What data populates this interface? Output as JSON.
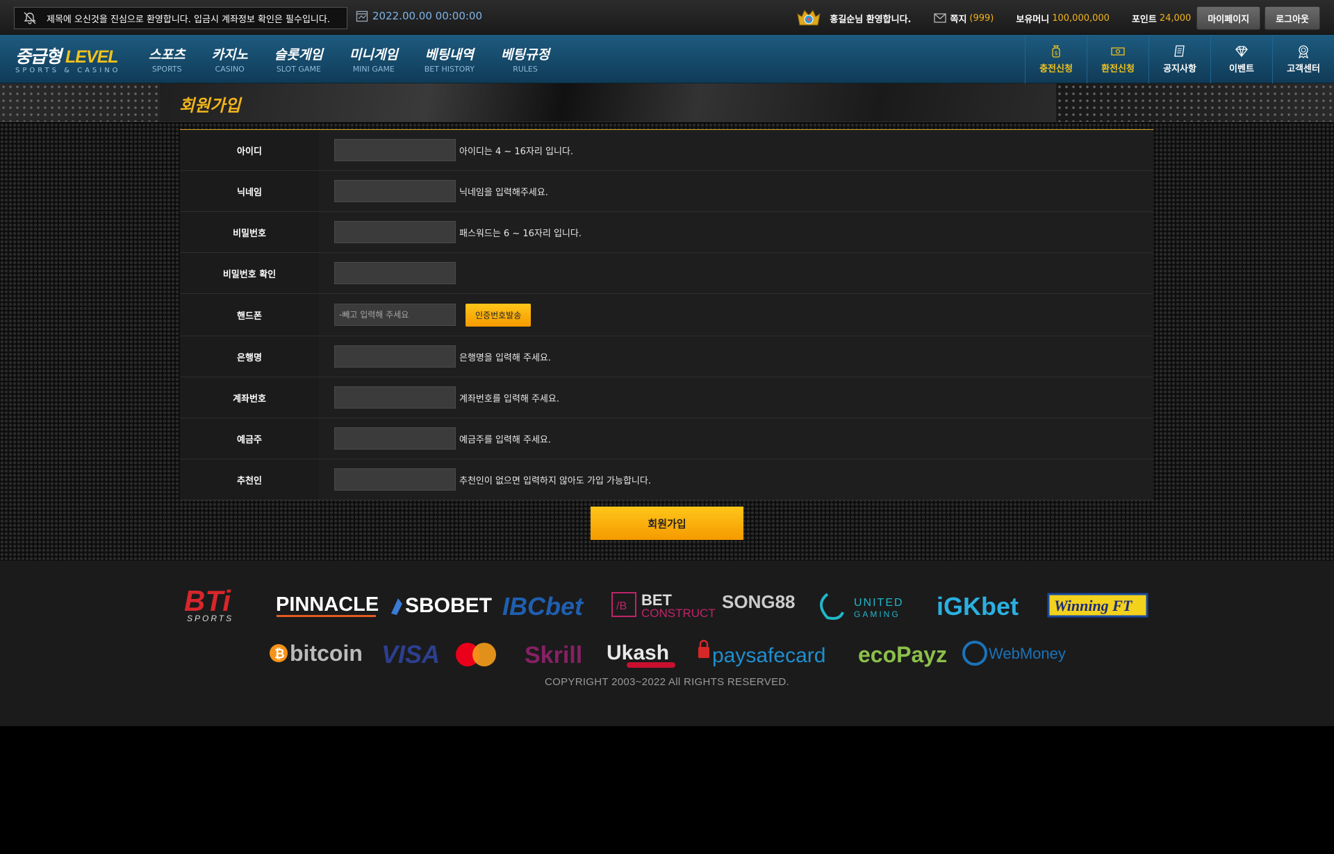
{
  "topbar": {
    "notice": "제목에 오신것을 진심으로 환영합니다. 입금시 계좌정보 확인은 필수입니다.",
    "datetime": "2022.00.00  00:00:00",
    "welcome": "홍길순님 환영합니다.",
    "message_label": "쪽지",
    "message_count": "(999)",
    "money_label": "보유머니",
    "money_value": "100,000,000",
    "point_label": "포인트",
    "point_value": "24,000",
    "mypage_button": "마이페이지",
    "logout_button": "로그아웃"
  },
  "logo": {
    "main_a": "중급형",
    "main_b": "LEVEL",
    "sub": "SPORTS & CASINO"
  },
  "nav": [
    {
      "kr": "스포츠",
      "en": "SPORTS"
    },
    {
      "kr": "카지노",
      "en": "CASINO"
    },
    {
      "kr": "슬롯게임",
      "en": "SLOT GAME"
    },
    {
      "kr": "미니게임",
      "en": "MINI GAME"
    },
    {
      "kr": "베팅내역",
      "en": "BET HISTORY"
    },
    {
      "kr": "베팅규정",
      "en": "RULES"
    }
  ],
  "quicknav": [
    {
      "label": "충전신청",
      "icon": "money-bag-icon"
    },
    {
      "label": "환전신청",
      "icon": "cash-icon"
    },
    {
      "label": "공지사항",
      "icon": "notice-icon"
    },
    {
      "label": "이벤트",
      "icon": "diamond-icon"
    },
    {
      "label": "고객센터",
      "icon": "medal-icon"
    }
  ],
  "page_title": "회원가입",
  "form": {
    "rows": [
      {
        "label": "아이디",
        "placeholder": "",
        "hint": "아이디는 4 ~ 16자리 입니다."
      },
      {
        "label": "닉네임",
        "placeholder": "",
        "hint": "닉네임을 입력해주세요."
      },
      {
        "label": "비밀번호",
        "placeholder": "",
        "hint": "패스워드는 6 ~ 16자리 입니다."
      },
      {
        "label": "비밀번호 확인",
        "placeholder": "",
        "hint": ""
      },
      {
        "label": "핸드폰",
        "placeholder": "-빼고 입력해 주세요",
        "hint": ""
      },
      {
        "label": "은행명",
        "placeholder": "",
        "hint": "은행명을 입력해 주세요."
      },
      {
        "label": "계좌번호",
        "placeholder": "",
        "hint": "계좌번호를 입력해 주세요."
      },
      {
        "label": "예금주",
        "placeholder": "",
        "hint": "예금주를 입력해 주세요."
      },
      {
        "label": "추천인",
        "placeholder": "",
        "hint": "추천인이 없으면 입력하지 않아도 가입 가능합니다."
      }
    ],
    "sms_button": "인증번호발송",
    "submit_button": "회원가입"
  },
  "footer": {
    "providers": [
      "BTi",
      "SPORTS",
      "PINNACLE",
      "SBOBET",
      "IBCbet",
      "BET",
      "CONSTRUCT",
      "SONG88",
      "UNITED",
      "GAMING",
      "iGKbet",
      "Winning FT"
    ],
    "payments": [
      "bitcoin",
      "VISA",
      "Skrill",
      "Ukash",
      "paysafecard",
      "ecoPayz",
      "WebMoney"
    ],
    "copyright": "COPYRIGHT 2003~2022 All RIGHTS RESERVED."
  }
}
